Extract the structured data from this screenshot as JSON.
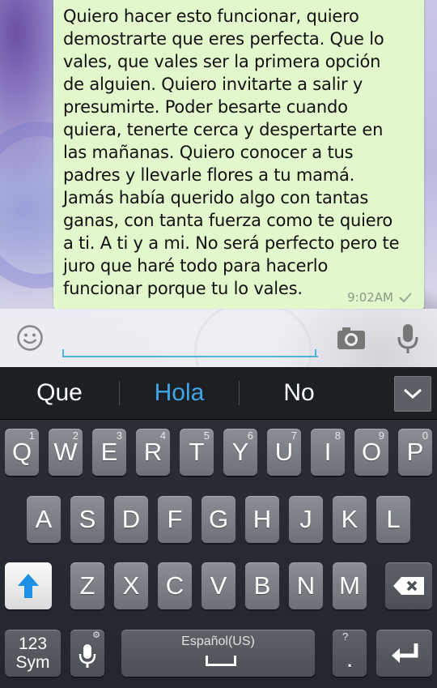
{
  "chat": {
    "message": {
      "text": "Quiero hacer esto funcionar, quiero\ndemostrarte que eres perfecta. Que lo\nvales, que vales ser la primera opción\nde alguien. Quiero invitarte a salir y\npresumirte. Poder besarte cuando\nquiera, tenerte cerca y despertarte en\nlas mañanas.  Quiero conocer a tus\npadres y llevarle flores a tu mamá.\nJamás había querido algo con tantas\nganas, con tanta fuerza como te quiero\na ti. A ti y a mi. No será perfecto pero te\njuro que haré todo para hacerlo\nfuncionar porque tu lo vales.",
      "time": "9:02AM",
      "status_icon": "single-check-icon"
    }
  },
  "input_bar": {
    "emoji_icon": "smiley-icon",
    "value": "",
    "camera_icon": "camera-icon",
    "mic_icon": "microphone-icon"
  },
  "keyboard": {
    "suggestions": [
      "Que",
      "Hola",
      "No"
    ],
    "active_suggestion_color": "#3ea7e7",
    "collapse_icon": "chevron-down-icon",
    "row1": [
      {
        "key": "Q",
        "hint": "1"
      },
      {
        "key": "W",
        "hint": "2"
      },
      {
        "key": "E",
        "hint": "3"
      },
      {
        "key": "R",
        "hint": "4"
      },
      {
        "key": "T",
        "hint": "5"
      },
      {
        "key": "Y",
        "hint": "6"
      },
      {
        "key": "U",
        "hint": "7"
      },
      {
        "key": "I",
        "hint": "8"
      },
      {
        "key": "O",
        "hint": "9"
      },
      {
        "key": "P",
        "hint": "0"
      }
    ],
    "row2": [
      "A",
      "S",
      "D",
      "F",
      "G",
      "H",
      "J",
      "K",
      "L"
    ],
    "row3": [
      "Z",
      "X",
      "C",
      "V",
      "B",
      "N",
      "M"
    ],
    "shift_icon": "shift-arrow-icon",
    "backspace_icon": "backspace-icon",
    "sym_label_top": "123",
    "sym_label_bottom": "Sym",
    "voice_icon": "microphone-icon",
    "voice_hint": "⚙",
    "space_label": "Español(US)",
    "period_key": ".",
    "period_hint": "?",
    "enter_icon": "enter-arrow-icon"
  },
  "colors": {
    "bubble": "#e2f7cb",
    "input_underline": "#4fb3dc",
    "shift_blue": "#1e8fe6",
    "keyboard_bg": "#22262d"
  }
}
